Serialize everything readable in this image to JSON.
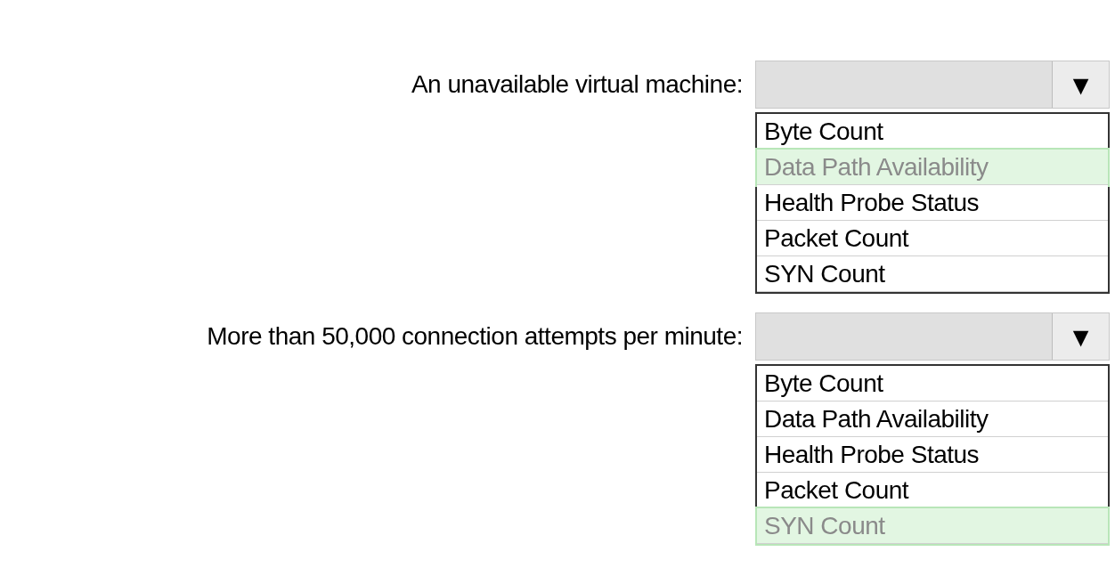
{
  "questions": [
    {
      "label": "An unavailable virtual machine:",
      "arrow": "▼",
      "options": [
        {
          "label": "Byte Count",
          "selected": false
        },
        {
          "label": "Data Path Availability",
          "selected": true
        },
        {
          "label": "Health Probe Status",
          "selected": false
        },
        {
          "label": "Packet Count",
          "selected": false
        },
        {
          "label": "SYN Count",
          "selected": false
        }
      ]
    },
    {
      "label": "More than 50,000 connection attempts per minute:",
      "arrow": "▼",
      "options": [
        {
          "label": "Byte Count",
          "selected": false
        },
        {
          "label": "Data Path Availability",
          "selected": false
        },
        {
          "label": "Health Probe Status",
          "selected": false
        },
        {
          "label": "Packet Count",
          "selected": false
        },
        {
          "label": "SYN Count",
          "selected": true
        }
      ]
    }
  ]
}
